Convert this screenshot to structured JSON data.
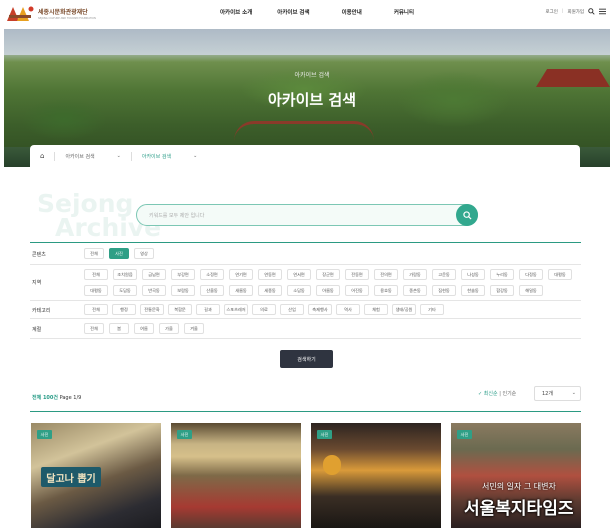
{
  "logo": {
    "title": "세종시문화관광재단",
    "subtitle": "SEJONG CULTURE AND TOURISM FOUNDATION"
  },
  "nav": {
    "items": [
      "아카이브 소개",
      "아카이브 검색",
      "이용안내",
      "커뮤니티"
    ]
  },
  "util": {
    "login": "로그인",
    "join": "회원가입"
  },
  "hero": {
    "sub": "아카이브 검색",
    "title": "아카이브 검색"
  },
  "breadcrumb": {
    "level1": "아카이브 검색",
    "level2": "아카이브 검색"
  },
  "watermark": {
    "line1": "Sejong",
    "line2": "Archive"
  },
  "search": {
    "placeholder": "키워드를 모두 제안 입니다"
  },
  "filters": {
    "content": {
      "label": "콘텐츠",
      "chips": [
        "전체",
        "사진",
        "영상"
      ],
      "active": 1
    },
    "region": {
      "label": "지역",
      "row1": [
        "전체",
        "조치원읍",
        "금남면",
        "부강면",
        "소정면",
        "연기면",
        "연동면",
        "연서면",
        "장군면",
        "전동면",
        "전의면",
        "가람동",
        "고운동",
        "나성동",
        "누리동",
        "다정동",
        "대평동"
      ],
      "row2": [
        "대평동",
        "도담동",
        "반곡동",
        "보람동",
        "산울동",
        "새롬동",
        "세종동",
        "소담동",
        "아름동",
        "어진동",
        "용호동",
        "종촌동",
        "집현동",
        "한솔동",
        "합강동",
        "해밀동"
      ]
    },
    "category": {
      "label": "카테고리",
      "chips": [
        "전체",
        "행정",
        "전통문화",
        "복합문",
        "길과",
        "스포츠레저",
        "의료",
        "산업",
        "축제행사",
        "역사",
        "체험",
        "생태/공원",
        "기타"
      ]
    },
    "season": {
      "label": "계절",
      "chips": [
        "전체",
        "봄",
        "여름",
        "가을",
        "겨울"
      ]
    }
  },
  "search_button": "검색하기",
  "results": {
    "total_label": "전체 100건",
    "page_label": "Page 1/9",
    "sort_new": "최신순",
    "sort_popular": "인기순",
    "per_page": "12개"
  },
  "cards": [
    {
      "badge": "사진",
      "sign": "달고나 뽑기"
    },
    {
      "badge": "사진"
    },
    {
      "badge": "사진"
    },
    {
      "badge": "사진",
      "caption": "서민의 일자 그 대변자"
    }
  ],
  "press_watermark": "서울복지타임즈",
  "colors": {
    "accent": "#2f9f86",
    "dark_button": "#2f3440"
  }
}
